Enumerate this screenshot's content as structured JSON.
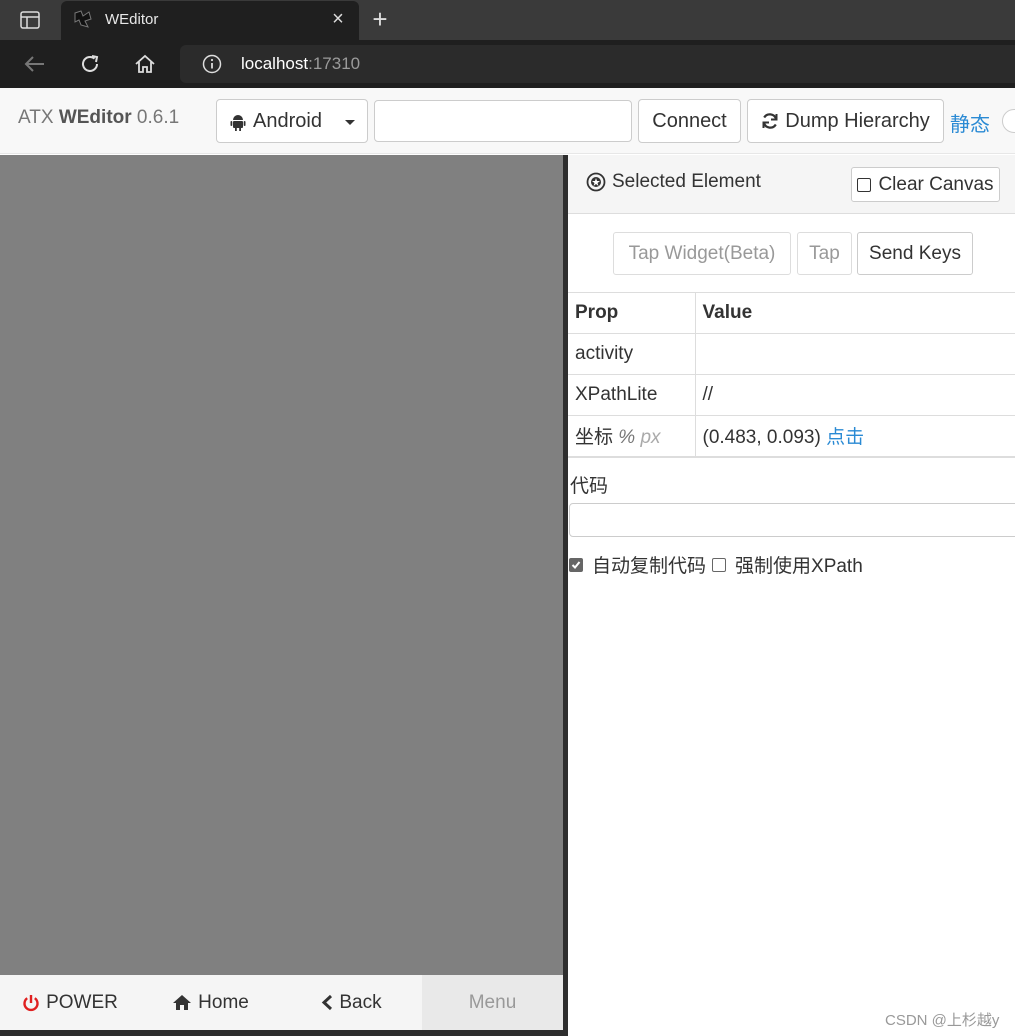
{
  "browser": {
    "tab_title": "WEditor",
    "tab_close": "×",
    "new_tab": "+",
    "url_host": "localhost",
    "url_port": ":17310"
  },
  "header": {
    "brand_prefix": "ATX ",
    "brand_name": "WEditor",
    "brand_version": " 0.6.1",
    "platform": "Android",
    "serial_value": "",
    "connect_label": "Connect",
    "dump_label": "Dump Hierarchy",
    "static_label": "静态"
  },
  "device": {
    "power_label": "POWER",
    "home_label": "Home",
    "back_label": "Back",
    "menu_label": "Menu"
  },
  "inspector": {
    "title": "Selected Element",
    "clear_canvas_label": "Clear Canvas",
    "tap_widget_label": "Tap Widget(Beta)",
    "tap_label": "Tap",
    "send_keys_label": "Send Keys",
    "table": {
      "headers": [
        "Prop",
        "Value"
      ],
      "activity_label": "activity",
      "activity_value": "",
      "xpath_label": "XPathLite",
      "xpath_value": "//",
      "coord_label": "坐标",
      "coord_unit_pct": "%",
      "coord_unit_px": "px",
      "coord_value": "(0.483, 0.093)",
      "coord_action": "点击"
    },
    "code_label": "代码",
    "code_value": "",
    "auto_copy_label": "自动复制代码",
    "auto_copy_checked": true,
    "force_xpath_label": "强制使用XPath",
    "force_xpath_checked": false
  },
  "watermark": "CSDN @上杉越y",
  "colors": {
    "device_bg": "#808080",
    "link": "#2a8ad4",
    "power_red": "#e02020"
  }
}
